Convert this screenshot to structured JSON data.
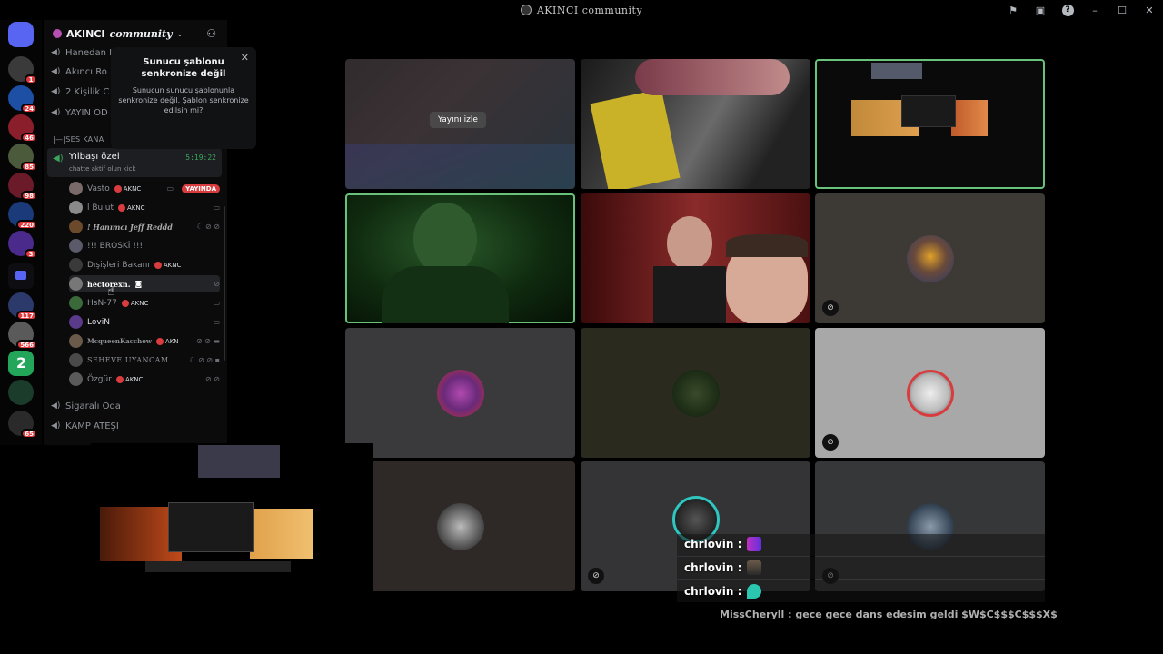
{
  "window": {
    "title": "AKINCI community",
    "controls": [
      "flag-icon",
      "screen-icon",
      "help-icon",
      "minimize-icon",
      "maximize-icon",
      "close-icon"
    ]
  },
  "rail": {
    "badges": [
      "1",
      "24",
      "46",
      "85",
      "98",
      "220",
      "3",
      "117",
      "566",
      "2",
      "65"
    ]
  },
  "server": {
    "name_bold": "AKINCI",
    "name_italic": "community"
  },
  "channels": {
    "top": [
      {
        "label": "Hanedan H"
      },
      {
        "label": "Akıncı Ro"
      },
      {
        "label": "2 Kişilik C"
      },
      {
        "label": "YAYIN OD"
      }
    ],
    "category": "|—|SES KANA",
    "active": {
      "label": "Yılbaşı özel",
      "subtitle": "chatte aktif olun kick",
      "timer": "5:19:22"
    },
    "bottom": [
      {
        "label": "Sigaralı Oda"
      },
      {
        "label": "KAMP ATEŞİ"
      }
    ]
  },
  "members": [
    {
      "name": "Vasto",
      "tag": "AKNC",
      "live": "YAYINDA",
      "icons": "▭"
    },
    {
      "name": "l Bulut",
      "tag": "AKNC",
      "icons": "▭"
    },
    {
      "name": "! Hanımcı Jeff Reddd",
      "tag": "",
      "icons": "☾ ⊘ ⊘"
    },
    {
      "name": "!!! BROSKİ !!!",
      "tag": "",
      "icons": ""
    },
    {
      "name": "Dışişleri Bakanı",
      "tag": "AKNC",
      "icons": ""
    },
    {
      "name": "hectorexn.",
      "tag": "",
      "icons": "⊘"
    },
    {
      "name": "HsN-77",
      "tag": "AKNC",
      "icons": "▭"
    },
    {
      "name": "LoviN",
      "tag": "",
      "icons": "▭"
    },
    {
      "name": "McqueenKacchow",
      "tag": "AKN",
      "icons": "⊘ ⊘ ▬"
    },
    {
      "name": "SEHEVE UYANCAM",
      "tag": "",
      "icons": "☾ ⊘ ⊘ ▪"
    },
    {
      "name": "Özgür",
      "tag": "AKNC",
      "icons": "⊘ ⊘"
    }
  ],
  "tooltip": {
    "title": "Sunucu şablonu senkronize değil",
    "body": "Sunucun sunucu şablonunla senkronize değil. Şablon senkronize edilsin mi?"
  },
  "stage": {
    "watch_label": "Yayını izle"
  },
  "overlay_chat": [
    {
      "user": "chrlovin",
      "sep": ":"
    },
    {
      "user": "chrlovin",
      "sep": ":"
    },
    {
      "user": "chrlovin",
      "sep": ":"
    }
  ],
  "bottom_chat": {
    "user": "MissCheryll",
    "message": ": gece gece dans edesim geldi $W$C$$$C$$$X$"
  },
  "colors": {
    "speaking": "#68c27a",
    "live_badge": "#d83c3e",
    "timer": "#3ba55c",
    "tag_dot": "#d83c3e"
  }
}
